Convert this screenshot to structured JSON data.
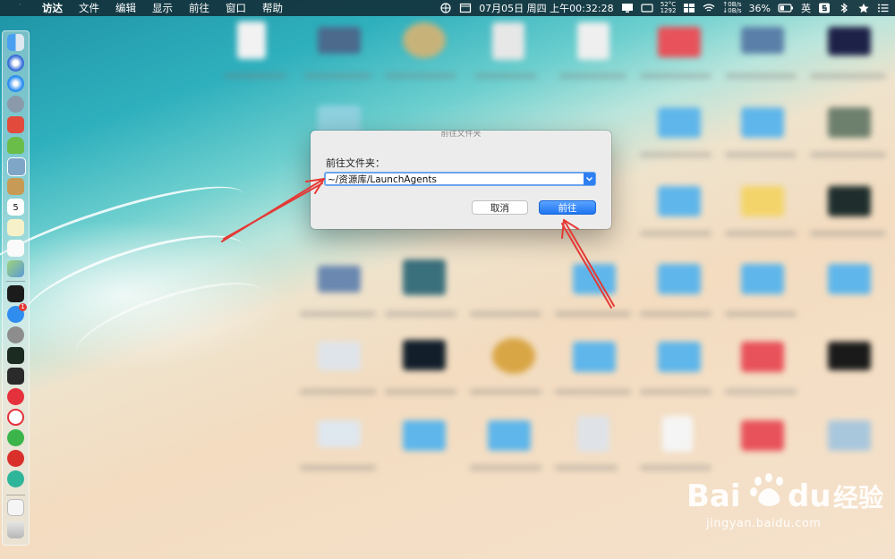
{
  "menubar": {
    "app_name": "访达",
    "items": [
      "文件",
      "编辑",
      "显示",
      "前往",
      "窗口",
      "帮助"
    ],
    "datetime": "07月05日 周四 上午00:32:28",
    "temperature": "52°C",
    "temperature_sub": "1292",
    "net_up": "↑0B/s",
    "net_down": "↓0B/s",
    "battery": "36%",
    "input_method": "英"
  },
  "dock": {
    "icons": [
      "finder-icon",
      "siri-icon",
      "safari-icon",
      "launchpad-icon",
      "textedit-icon",
      "android-icon",
      "preview-icon",
      "notes-icon",
      "calendar-icon",
      "stickies-icon",
      "reminders-icon",
      "maps-icon",
      "terminal-icon",
      "app-store-icon",
      "system-preferences-icon",
      "activity-monitor-icon",
      "console-icon",
      "vivaldi-icon",
      "yandex-icon",
      "wechat-icon",
      "netease-music-icon",
      "360-icon",
      "document-icon",
      "trash-icon"
    ],
    "calendar_day": "5",
    "app_store_badge": "1"
  },
  "dialog": {
    "title": "前往文件夹",
    "label": "前往文件夹：",
    "path_value": "~/资源库/LaunchAgents",
    "cancel_label": "取消",
    "go_label": "前往"
  },
  "watermark": {
    "logo": "Bai du 经验",
    "url": "jingyan.baidu.com"
  },
  "colors": {
    "menubar_bg": "#12323c",
    "accent_blue": "#1f74f0",
    "annotation_red": "#e53935"
  }
}
